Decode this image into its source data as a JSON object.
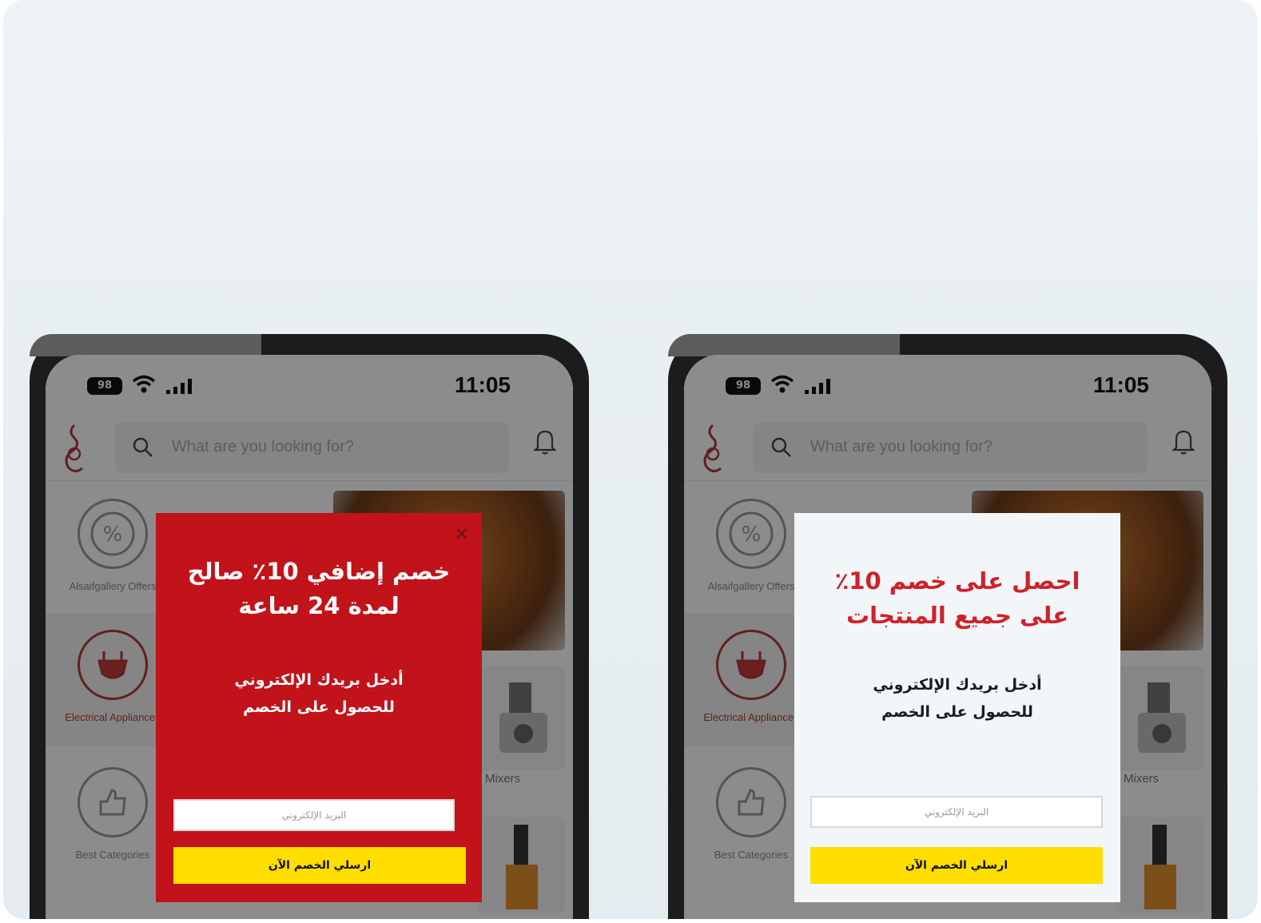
{
  "phones": [
    {
      "variant": "red",
      "status": {
        "battery": "98",
        "time": "11:05"
      },
      "search_placeholder": "What are you looking for?",
      "categories": [
        {
          "label": "Alsaifgallery Offers"
        },
        {
          "label": "Electrical Appliances"
        },
        {
          "label": "Best Categories"
        }
      ],
      "tile_label": "Mixers",
      "popup": {
        "close": "×",
        "title": "خصم إضافي 10٪ صالح لمدة 24 ساعة",
        "subtitle_line1": "أدخل بريدك الإلكتروني",
        "subtitle_line2": "للحصول على الخصم",
        "email_placeholder": "البريد الإلكتروني",
        "cta": "ارسلي الخصم الآن"
      }
    },
    {
      "variant": "white",
      "status": {
        "battery": "98",
        "time": "11:05"
      },
      "search_placeholder": "What are you looking for?",
      "categories": [
        {
          "label": "Alsaifgallery Offers"
        },
        {
          "label": "Electrical Appliances"
        },
        {
          "label": "Best Categories"
        }
      ],
      "tile_label": "Mixers",
      "popup": {
        "title": "احصل على خصم 10٪ على جميع المنتجات",
        "subtitle_line1": "أدخل بريدك الإلكتروني",
        "subtitle_line2": "للحصول على الخصم",
        "email_placeholder": "البريد الإلكتروني",
        "cta": "ارسلي الخصم الآن"
      }
    }
  ],
  "colors": {
    "popup_red": "#c2121a",
    "cta_yellow": "#ffde00",
    "title_red": "#d0202a"
  }
}
